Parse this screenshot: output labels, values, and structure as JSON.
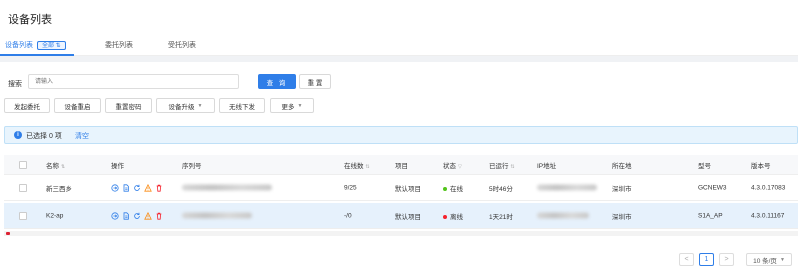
{
  "page": {
    "title": "设备列表"
  },
  "tabs": [
    {
      "label": "设备列表",
      "badge": "全部 ⇅"
    },
    {
      "label": "委托列表"
    },
    {
      "label": "受托列表"
    }
  ],
  "search": {
    "label": "搜索",
    "placeholder": "请输入",
    "query_label": "查 询",
    "reset_label": "重 置"
  },
  "actions": {
    "delegate": "发起委托",
    "restart": "设备重启",
    "reset_password": "重置密码",
    "upgrade": "设备升级",
    "wireless_deploy": "无线下发",
    "more": "更多"
  },
  "alert": {
    "icon": "info-icon",
    "text": "已选择 0 项",
    "clear": "清空"
  },
  "table": {
    "columns": {
      "name": "名称",
      "ops": "操作",
      "serial": "序列号",
      "online": "在线数",
      "project": "项目",
      "status": "状态",
      "uptime": "已运行",
      "ip": "IP地址",
      "location": "所在地",
      "model": "型号",
      "version": "版本号"
    },
    "rows": [
      {
        "name": "新三西乡",
        "online": "9/25",
        "project": "默认项目",
        "status": "在线",
        "status_color": "#52c41a",
        "uptime": "5时46分",
        "location": "深圳市",
        "model": "GCNEW3",
        "version": "4.3.0.17083"
      },
      {
        "name": "K2-ap",
        "online": "-/0",
        "project": "默认项目",
        "status": "离线",
        "status_color": "#f5222d",
        "uptime": "1天21时",
        "location": "深圳市",
        "model": "S1A_AP",
        "version": "4.3.0.11167"
      }
    ],
    "op_icons": [
      "login-icon",
      "document-icon",
      "refresh-icon",
      "warning-icon",
      "delete-icon"
    ]
  },
  "pagination": {
    "prev": "<",
    "current": "1",
    "next": ">",
    "page_size": "10 条/页"
  },
  "colors": {
    "primary": "#2f7ee8",
    "online": "#52c41a",
    "offline": "#f5222d",
    "warning": "#fa8c16"
  }
}
